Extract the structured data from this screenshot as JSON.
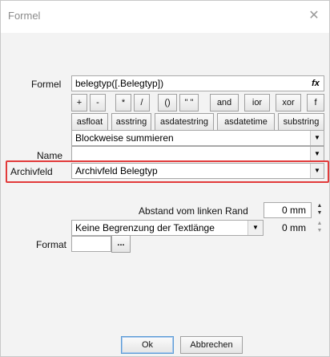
{
  "window": {
    "title": "Formel",
    "close_glyph": "✕"
  },
  "formel": {
    "label": "Formel",
    "value": "belegtyp([.Belegtyp])",
    "fx_label": "fx",
    "ops": [
      "+",
      "-",
      "*",
      "/",
      "()",
      "\" \"",
      "and",
      "ior",
      "xor",
      "f"
    ],
    "funcs": [
      "asfloat",
      "asstring",
      "asdatestring",
      "asdatetime",
      "substring"
    ]
  },
  "summary_combo": {
    "value": "Blockweise summieren"
  },
  "name": {
    "label": "Name",
    "value": ""
  },
  "archivfeld": {
    "label": "Archivfeld",
    "value": "Archivfeld Belegtyp"
  },
  "abstand": {
    "label": "Abstand vom linken Rand",
    "value": "0 mm"
  },
  "textlaenge": {
    "value": "Keine Begrenzung der Textlänge",
    "mm_value": "0 mm"
  },
  "format": {
    "label": "Format",
    "value": "",
    "button": "..."
  },
  "buttons": {
    "ok": "Ok",
    "cancel": "Abbrechen"
  }
}
